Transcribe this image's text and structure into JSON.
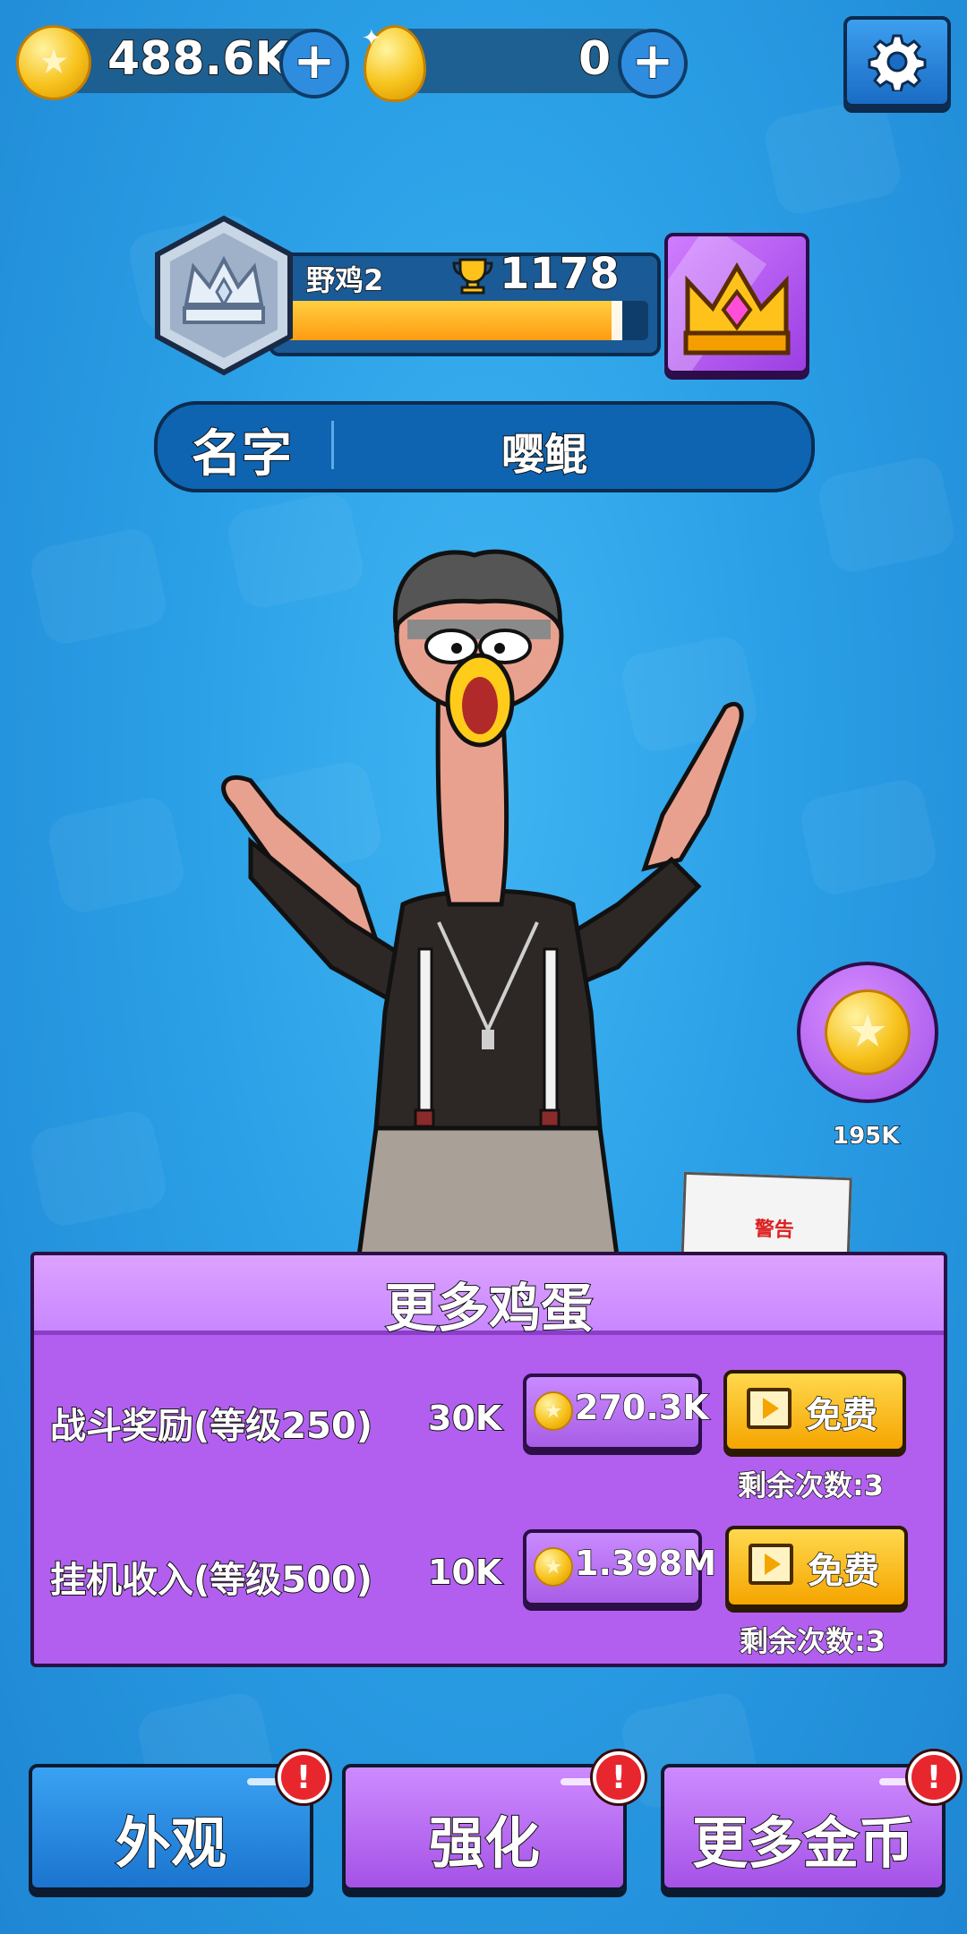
{
  "currency": {
    "coins": "488.6K",
    "eggs": "0"
  },
  "rank": {
    "name": "野鸡2",
    "trophies": "1178",
    "progress": 0.93
  },
  "profile": {
    "name_label": "名字",
    "name_value": "嘤鲲"
  },
  "side_reward": {
    "amount": "195K"
  },
  "poster_text": "警告",
  "panel": {
    "title": "更多鸡蛋",
    "rows": [
      {
        "label": "战斗奖励(等级250)",
        "value": "30K",
        "cost": "270.3K",
        "free": "免费",
        "remaining": "剩余次数:3"
      },
      {
        "label": "挂机收入(等级500)",
        "value": "10K",
        "cost": "1.398M",
        "free": "免费",
        "remaining": "剩余次数:3"
      }
    ]
  },
  "bottom_nav": [
    {
      "label": "外观",
      "color": "#1e88e0"
    },
    {
      "label": "强化",
      "color": "#b05ff0"
    },
    {
      "label": "更多金币",
      "color": "#b05ff0"
    }
  ],
  "colors": {
    "background": "#2a9fe6",
    "panel": "#b25ff0",
    "free_button": "#f5b400",
    "alert": "#e8262e"
  }
}
